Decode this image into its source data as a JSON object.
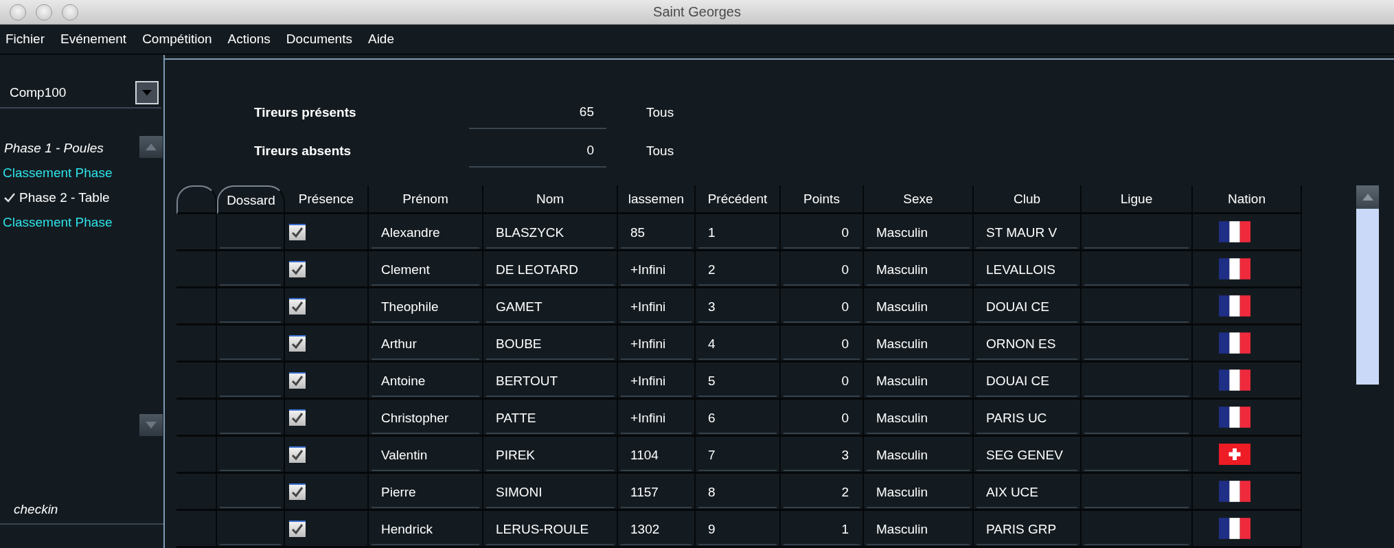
{
  "window": {
    "title": "Saint Georges"
  },
  "menu": [
    "Fichier",
    "Evénement",
    "Compétition",
    "Actions",
    "Documents",
    "Aide"
  ],
  "sidebar": {
    "competition": "Comp100",
    "items": [
      {
        "label": "Phase 1 - Poules",
        "kind": "phase",
        "current": true,
        "checked": false
      },
      {
        "label": "Classement Phase",
        "kind": "ranking",
        "current": false,
        "checked": false
      },
      {
        "label": "Phase 2 - Table",
        "kind": "phase",
        "current": false,
        "checked": true
      },
      {
        "label": "Classement Phase",
        "kind": "ranking",
        "current": false,
        "checked": false
      }
    ],
    "footer": "checkin"
  },
  "stats": [
    {
      "label": "Tireurs présents",
      "value": "65",
      "filter": "Tous"
    },
    {
      "label": "Tireurs absents",
      "value": "0",
      "filter": "Tous"
    }
  ],
  "table": {
    "columns": [
      "Dossard",
      "Présence",
      "Prénom",
      "Nom",
      "lassemen",
      "Précédent",
      "Points",
      "Sexe",
      "Club",
      "Ligue",
      "Nation"
    ],
    "rows": [
      {
        "present": true,
        "first_name": "Alexandre",
        "last_name": "BLASZYCK",
        "ranking": "85",
        "previous": "1",
        "points": "0",
        "sex": "Masculin",
        "club": "ST MAUR V",
        "nation": {
          "kind": "fr"
        }
      },
      {
        "present": true,
        "first_name": "Clement",
        "last_name": "DE LEOTARD",
        "ranking": "+Infini",
        "previous": "2",
        "points": "0",
        "sex": "Masculin",
        "club": "LEVALLOIS",
        "nation": {
          "kind": "fr"
        }
      },
      {
        "present": true,
        "first_name": "Theophile",
        "last_name": "GAMET",
        "ranking": "+Infini",
        "previous": "3",
        "points": "0",
        "sex": "Masculin",
        "club": "DOUAI CE",
        "nation": {
          "kind": "fr"
        }
      },
      {
        "present": true,
        "first_name": "Arthur",
        "last_name": "BOUBE",
        "ranking": "+Infini",
        "previous": "4",
        "points": "0",
        "sex": "Masculin",
        "club": "ORNON ES",
        "nation": {
          "kind": "fr"
        }
      },
      {
        "present": true,
        "first_name": "Antoine",
        "last_name": "BERTOUT",
        "ranking": "+Infini",
        "previous": "5",
        "points": "0",
        "sex": "Masculin",
        "club": "DOUAI CE",
        "nation": {
          "kind": "fr"
        }
      },
      {
        "present": true,
        "first_name": "Christopher",
        "last_name": "PATTE",
        "ranking": "+Infini",
        "previous": "6",
        "points": "0",
        "sex": "Masculin",
        "club": "PARIS UC",
        "nation": {
          "kind": "fr"
        }
      },
      {
        "present": true,
        "first_name": "Valentin",
        "last_name": "PIREK",
        "ranking": "1104",
        "previous": "7",
        "points": "3",
        "sex": "Masculin",
        "club": "SEG GENEV",
        "nation": {
          "kind": "ch"
        }
      },
      {
        "present": true,
        "first_name": "Pierre",
        "last_name": "SIMONI",
        "ranking": "1157",
        "previous": "8",
        "points": "2",
        "sex": "Masculin",
        "club": "AIX UCE",
        "nation": {
          "kind": "fr"
        }
      },
      {
        "present": true,
        "first_name": "Hendrick",
        "last_name": "LERUS-ROULE",
        "ranking": "1302",
        "previous": "9",
        "points": "1",
        "sex": "Masculin",
        "club": "PARIS GRP",
        "nation": {
          "kind": "fr"
        }
      }
    ]
  }
}
